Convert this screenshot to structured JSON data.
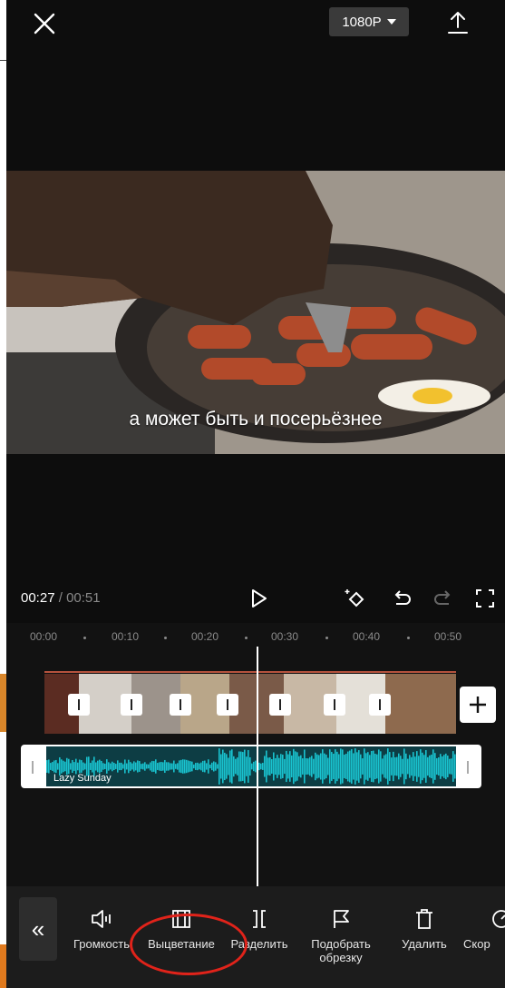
{
  "header": {
    "close_icon": "close-icon",
    "resolution": "1080P",
    "export_icon": "upload-icon"
  },
  "video": {
    "subtitle": "а может быть и посерьёзнее"
  },
  "playback": {
    "current_time": "00:27",
    "separator": " / ",
    "total_time": "00:51",
    "icons": [
      "play-icon",
      "keyframe-icon",
      "undo-icon",
      "redo-icon",
      "fullscreen-icon"
    ]
  },
  "timeline": {
    "ruler": [
      "00:00",
      "00:10",
      "00:20",
      "00:30",
      "00:40",
      "00:50"
    ],
    "audio_track_label": "Lazy Sunday",
    "add_clip_icon": "plus-icon"
  },
  "toolbar": {
    "collapse_icon": "double-chevron-left-icon",
    "tools": [
      {
        "label": "Громкость",
        "icon": "volume-icon"
      },
      {
        "label": "Выцветание",
        "icon": "fade-icon"
      },
      {
        "label": "Разделить",
        "icon": "split-icon"
      },
      {
        "label": "Подобрать обрезку",
        "icon": "flag-icon"
      },
      {
        "label": "Удалить",
        "icon": "delete-icon"
      },
      {
        "label": "Скор",
        "icon": "speed-icon"
      }
    ]
  },
  "colors": {
    "background": "#0d0d0d",
    "audio_wave": "#19c3cf",
    "highlight_circle": "#e0231a",
    "clip_border": "#b5523d"
  }
}
